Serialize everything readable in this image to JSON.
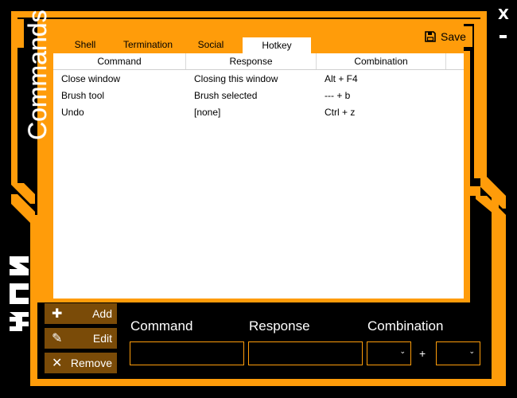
{
  "window": {
    "title": "Commands",
    "close_label": "X",
    "minimize_label": "-"
  },
  "tabs": [
    {
      "label": "Shell"
    },
    {
      "label": "Termination"
    },
    {
      "label": "Social"
    },
    {
      "label": "Hotkey",
      "active": true
    }
  ],
  "toolbar": {
    "save_label": "Save"
  },
  "table": {
    "columns": [
      "Command",
      "Response",
      "Combination"
    ],
    "rows": [
      [
        "Close window",
        "Closing this window",
        "Alt + F4"
      ],
      [
        "Brush tool",
        "Brush selected",
        "--- + b"
      ],
      [
        "Undo",
        "[none]",
        "Ctrl + z"
      ]
    ]
  },
  "actions": {
    "add_label": "Add",
    "edit_label": "Edit",
    "remove_label": "Remove"
  },
  "form": {
    "command_label": "Command",
    "response_label": "Response",
    "combination_label": "Combination",
    "command_value": "",
    "response_value": "",
    "modifier_value": "",
    "key_value": "",
    "plus_label": "+"
  },
  "colors": {
    "accent": "#ff9c0a",
    "background": "#000000",
    "button_dark": "#7a4b08"
  },
  "icons": {
    "save": "floppy-disk-icon",
    "add": "plus-icon",
    "edit": "pencil-icon",
    "remove": "x-icon"
  }
}
